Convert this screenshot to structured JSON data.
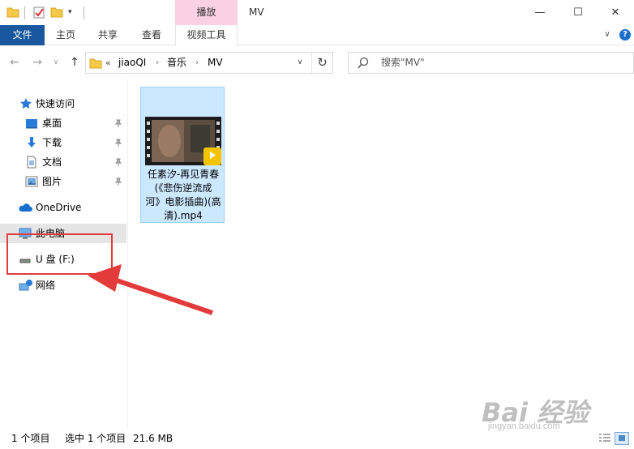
{
  "titlebar": {
    "context_tab": "播放",
    "window_title": "MV",
    "quick_menu_glyph": "▾",
    "minimize_glyph": "—",
    "maximize_glyph": "☐",
    "close_glyph": "✕"
  },
  "ribbon": {
    "tabs": [
      "文件",
      "主页",
      "共享",
      "查看",
      "视频工具"
    ],
    "expand_glyph": "∨",
    "help_glyph": "?"
  },
  "nav": {
    "back_glyph": "←",
    "forward_glyph": "→",
    "recent_glyph": "∨",
    "up_glyph": "↑"
  },
  "address": {
    "overflow_glyph": "«",
    "crumbs": [
      "jiaoQI",
      "音乐",
      "MV"
    ],
    "separator": "›",
    "dropdown_glyph": "∨",
    "refresh_glyph": "↻"
  },
  "search": {
    "placeholder": "搜索\"MV\""
  },
  "sidebar": {
    "items": [
      {
        "label": "快速访问",
        "icon": "star-icon"
      },
      {
        "label": "桌面",
        "icon": "desktop-icon",
        "pinned": true
      },
      {
        "label": "下载",
        "icon": "download-icon",
        "pinned": true
      },
      {
        "label": "文档",
        "icon": "document-icon",
        "pinned": true
      },
      {
        "label": "图片",
        "icon": "pictures-icon",
        "pinned": true
      },
      {
        "label": "OneDrive",
        "icon": "cloud-icon"
      },
      {
        "label": "此电脑",
        "icon": "computer-icon",
        "selected": true
      },
      {
        "label": "U 盘 (F:)",
        "icon": "usb-drive-icon"
      },
      {
        "label": "网络",
        "icon": "network-icon"
      }
    ],
    "pin_glyph": "📌"
  },
  "files": [
    {
      "name": "任素汐-再见青春(《悲伤逆流成河》电影插曲)(高清).mp4",
      "name_lines": [
        "任素汐-再见青春",
        "(《悲伤逆流成",
        "河》电影插曲)(高",
        "清).mp4"
      ],
      "badge": "Player",
      "selected": true
    }
  ],
  "status": {
    "count": "1 个项目",
    "selected": "选中 1 个项目",
    "size": "21.6 MB"
  },
  "colors": {
    "file_tab": "#19579e",
    "context_tab": "#f9d0e4",
    "selection": "#cce8ff",
    "annotation": "#e33b3b"
  },
  "watermark": {
    "brand": "Bai 经验",
    "url": "jingyan.baidu.com"
  }
}
